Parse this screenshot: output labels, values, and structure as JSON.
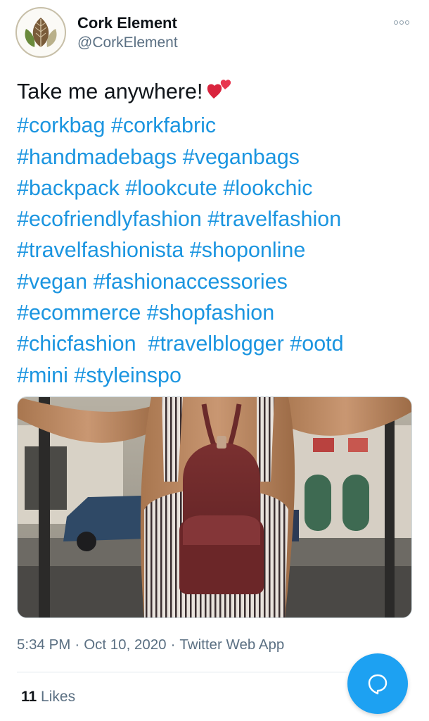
{
  "author": {
    "name": "Cork Element",
    "handle": "@CorkElement"
  },
  "tweet": {
    "intro": "Take me anywhere!",
    "emoji": "two-hearts-icon",
    "lines": [
      [
        "#corkbag",
        "#corkfabric"
      ],
      [
        "#handmadebags",
        "#veganbags"
      ],
      [
        "#backpack",
        "#lookcute",
        "#lookchic"
      ],
      [
        "#ecofriendlyfashion",
        "#travelfashion"
      ],
      [
        "#travelfashionista",
        "#shoponline"
      ],
      [
        "#vegan",
        "#fashionaccessories"
      ],
      [
        "#ecommerce",
        "#shopfashion"
      ],
      [
        "#chicfashion",
        "#travelblogger",
        "#ootd"
      ],
      [
        "#mini",
        "#styleinspo"
      ]
    ]
  },
  "meta": {
    "time": "5:34 PM",
    "date": "Oct 10, 2020",
    "source": "Twitter Web App",
    "separator": "·"
  },
  "engagement": {
    "likes_count": "11",
    "likes_label": "Likes"
  },
  "icons": {
    "more": "more-options-icon",
    "fab": "reply-bubble-icon"
  },
  "colors": {
    "link": "#1b95e0",
    "secondary_text": "#5b7083",
    "accent": "#1da1f2"
  }
}
